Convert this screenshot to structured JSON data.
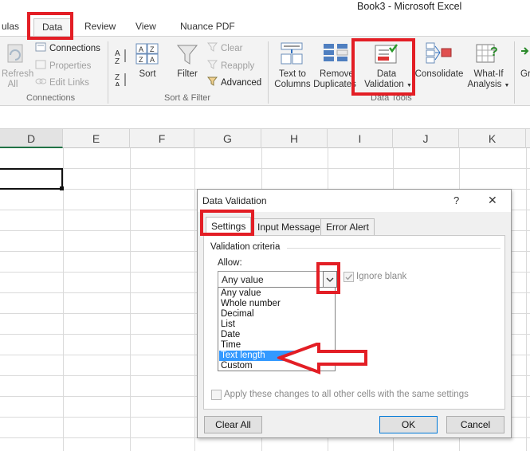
{
  "window": {
    "title": "Book3 - Microsoft Excel"
  },
  "ribbon_tabs": [
    {
      "label": "ulas",
      "active": false
    },
    {
      "label": "Data",
      "active": true
    },
    {
      "label": "Review",
      "active": false
    },
    {
      "label": "View",
      "active": false
    },
    {
      "label": "Nuance PDF",
      "active": false
    }
  ],
  "ribbon": {
    "connections_group": {
      "label": "Connections",
      "refresh_label_1": "Refresh",
      "refresh_label_2": "All",
      "connections": "Connections",
      "properties": "Properties",
      "edit_links": "Edit Links"
    },
    "sort_filter_group": {
      "label": "Sort & Filter",
      "sort": "Sort",
      "filter": "Filter",
      "clear": "Clear",
      "reapply": "Reapply",
      "advanced": "Advanced"
    },
    "data_tools_group": {
      "label": "Data Tools",
      "text_to_columns_1": "Text to",
      "text_to_columns_2": "Columns",
      "remove_duplicates_1": "Remove",
      "remove_duplicates_2": "Duplicates",
      "data_validation_1": "Data",
      "data_validation_2": "Validation",
      "consolidate": "Consolidate",
      "whatif_1": "What-If",
      "whatif_2": "Analysis",
      "partial": "Gr"
    }
  },
  "sheet": {
    "columns": [
      "D",
      "E",
      "F",
      "G",
      "H",
      "I",
      "J",
      "K"
    ],
    "selected_column": "D"
  },
  "dialog": {
    "title": "Data Validation",
    "help": "?",
    "close": "✕",
    "tabs": [
      "Settings",
      "Input Message",
      "Error Alert"
    ],
    "active_tab": "Settings",
    "section_title": "Validation criteria",
    "allow_label": "Allow:",
    "allow_value": "Any value",
    "options": [
      "Any value",
      "Whole number",
      "Decimal",
      "List",
      "Date",
      "Time",
      "Text length",
      "Custom"
    ],
    "highlighted_option": "Text length",
    "ignore_blank": "Ignore blank",
    "apply_all": "Apply these changes to all other cells with the same settings",
    "buttons": {
      "clear_all": "Clear All",
      "ok": "OK",
      "cancel": "Cancel"
    }
  },
  "colors": {
    "annotation_red": "#e31e25",
    "highlight_blue": "#3399ff",
    "excel_green": "#217346"
  }
}
